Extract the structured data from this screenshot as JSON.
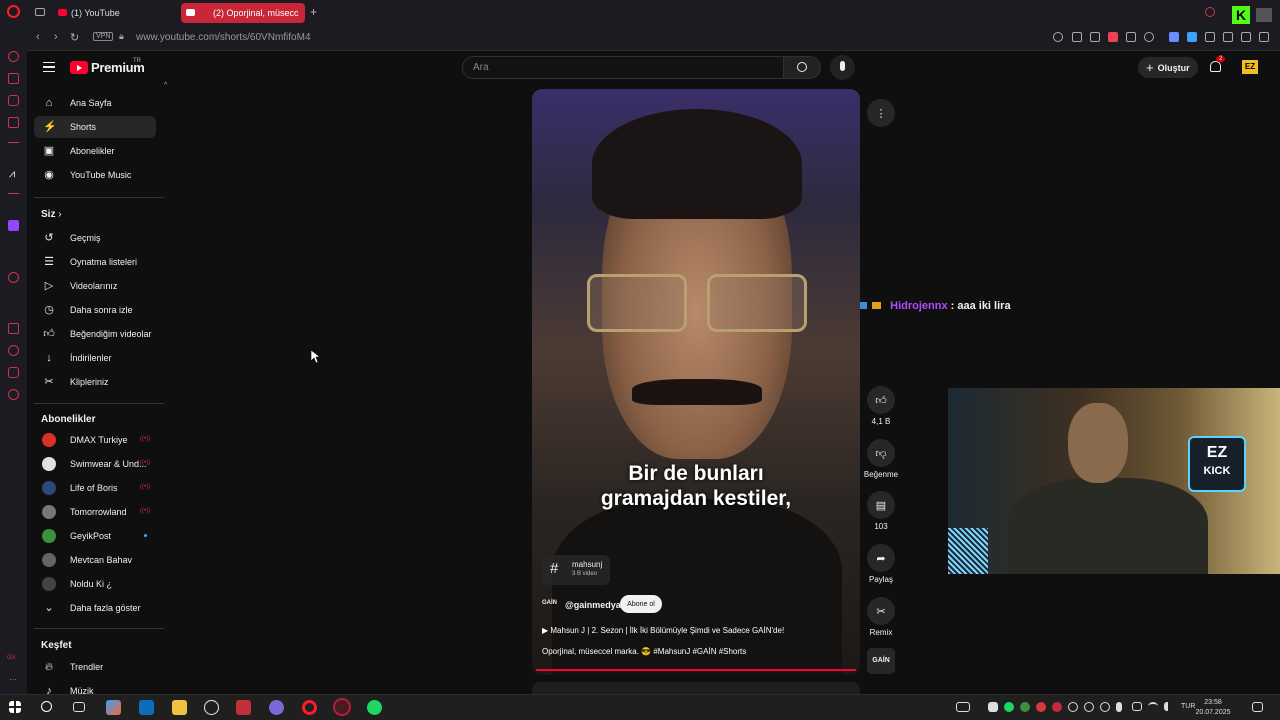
{
  "browser": {
    "tabs": [
      {
        "label": "(1) YouTube",
        "active": false
      },
      {
        "label": "(2) Oporjinal, müsecc",
        "active": true
      }
    ],
    "new_tab": "+",
    "vpn_label": "VPN",
    "url": "www.youtube.com/shorts/60VNmfifoM4"
  },
  "header": {
    "brand": "Premium",
    "brand_region": "TR",
    "search_placeholder": "Ara",
    "create_label": "Oluştur",
    "notification_count": "2"
  },
  "sidebar": {
    "main": [
      {
        "label": "Ana Sayfa",
        "icon": "home-icon"
      },
      {
        "label": "Shorts",
        "icon": "shorts-icon",
        "active": true
      },
      {
        "label": "Abonelikler",
        "icon": "subscriptions-icon"
      },
      {
        "label": "YouTube Music",
        "icon": "music-icon"
      }
    ],
    "you_heading": "Siz",
    "you": [
      {
        "label": "Geçmiş",
        "icon": "history-icon"
      },
      {
        "label": "Oynatma listeleri",
        "icon": "playlist-icon"
      },
      {
        "label": "Videolarınız",
        "icon": "video-icon"
      },
      {
        "label": "Daha sonra izle",
        "icon": "clock-icon"
      },
      {
        "label": "Beğendiğim videolar",
        "icon": "like-icon"
      },
      {
        "label": "İndirilenler",
        "icon": "download-icon"
      },
      {
        "label": "Klipleriniz",
        "icon": "scissors-icon"
      }
    ],
    "subs_heading": "Abonelikler",
    "subs": [
      {
        "label": "DMAX Turkiye",
        "color": "#d93025",
        "badge": "live"
      },
      {
        "label": "Swimwear & Und...",
        "color": "#e0e0e0",
        "badge": "live"
      },
      {
        "label": "Life of Boris",
        "color": "#2b4a7a",
        "badge": "live"
      },
      {
        "label": "Tomorrowland",
        "color": "#777777",
        "badge": "live"
      },
      {
        "label": "GeyikPost",
        "color": "#3c8f3c",
        "badge": "dot"
      },
      {
        "label": "Mevtcan Bahav",
        "color": "#6a5f6a",
        "badge": ""
      },
      {
        "label": "Noldu Ki ¿",
        "color": "#444444",
        "badge": ""
      }
    ],
    "show_more": "Daha fazla göster",
    "explore_heading": "Keşfet",
    "explore": [
      {
        "label": "Trendler",
        "icon": "trending-icon"
      },
      {
        "label": "Müzik",
        "icon": "music-note-icon"
      }
    ]
  },
  "video": {
    "subtitle_line1": "Bir de bunları",
    "subtitle_line2": "gramajdan kestiler,",
    "hashtag": "mahsunj",
    "hashtag_count": "3 B video",
    "channel_badge": "GAİN",
    "channel": "@gainmedya",
    "subscribe_label": "Abone ol",
    "title": "Mahsun J | 2. Sezon | İlk İki Bölümüyle Şimdi ve Sadece GAİN'de!",
    "desc": "Oporjinal, müseccel marka. 😎 #MahsunJ #GAİN #Shorts"
  },
  "actions": {
    "likes": "4,1 B",
    "dislike_label": "Beğenme",
    "comments": "103",
    "share_label": "Paylaş",
    "remix_label": "Remix",
    "channel_short": "GAİN"
  },
  "overlay": {
    "chat_user": "Hidrojennx",
    "chat_msg": " : aaa iki lira",
    "webcam_logo_top": "EZ",
    "webcam_logo_bottom": "KICK"
  },
  "taskbar": {
    "lang": "TUR",
    "time": "23:58",
    "date": "20.07.2025"
  },
  "colors": {
    "accent": "#ff0033",
    "tab_active": "#c9263a",
    "chat_user": "#b04cff"
  }
}
